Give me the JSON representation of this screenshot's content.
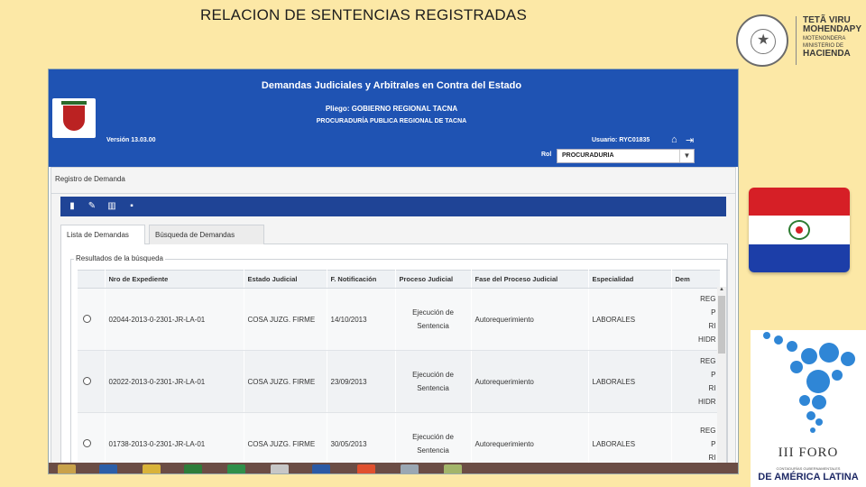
{
  "slide": {
    "title": "RELACION DE SENTENCIAS REGISTRADAS"
  },
  "hacienda_logo": {
    "line1": "TETÃ VIRU",
    "line2": "MOHENDAPY",
    "line3": "MOTENONDERA",
    "line4": "MINISTERIO DE",
    "line5": "HACIENDA"
  },
  "app": {
    "title": "Demandas Judiciales y Arbitrales en Contra del Estado",
    "pliego": "Pliego: GOBIERNO REGIONAL TACNA",
    "procuraduria": "PROCURADURÍA PUBLICA REGIONAL DE TACNA",
    "version": "Versión 13.03.00",
    "usuario": "Usuario: RYC01835",
    "rol_label": "Rol",
    "rol_value": "PROCURADURIA"
  },
  "panel": {
    "title": "Registro de Demanda",
    "tabs": [
      {
        "label": "Lista de Demandas",
        "active": true
      },
      {
        "label": "Búsqueda de Demandas",
        "active": false
      }
    ],
    "results_title": "Resultados de la búsqueda"
  },
  "table": {
    "headers": [
      "",
      "Nro de Expediente",
      "Estado Judicial",
      "F. Notificación",
      "Proceso Judicial",
      "Fase del Proceso Judicial",
      "Especialidad",
      "Dem"
    ],
    "rows": [
      {
        "expediente": "02044-2013-0-2301-JR-LA-01",
        "estado": "COSA JUZG. FIRME",
        "fecha": "14/10/2013",
        "proceso": "Ejecución de Sentencia",
        "fase": "Autorequerimiento",
        "especialidad": "LABORALES",
        "dem": [
          "REG",
          "P",
          "RI",
          "HIDR"
        ]
      },
      {
        "expediente": "02022-2013-0-2301-JR-LA-01",
        "estado": "COSA JUZG. FIRME",
        "fecha": "23/09/2013",
        "proceso": "Ejecución de Sentencia",
        "fase": "Autorequerimiento",
        "especialidad": "LABORALES",
        "dem": [
          "REG",
          "P",
          "RI",
          "HIDR"
        ]
      },
      {
        "expediente": "01738-2013-0-2301-JR-LA-01",
        "estado": "COSA JUZG. FIRME",
        "fecha": "30/05/2013",
        "proceso": "Ejecución de Sentencia",
        "fase": "Autorequerimiento",
        "especialidad": "LABORALES",
        "dem": [
          "REG",
          "P",
          "RI"
        ]
      }
    ]
  },
  "foro": {
    "title": "III FORO",
    "subtitle": "CONTADURÍAS GUBERNAMENTALES",
    "subtitle2": "DE AMÉRICA LATINA"
  },
  "colors": {
    "slide_bg": "#fce8a6",
    "header_blue": "#1f53b3",
    "toolbar_blue": "#1f4496",
    "taskbar": "#6b4d45"
  }
}
